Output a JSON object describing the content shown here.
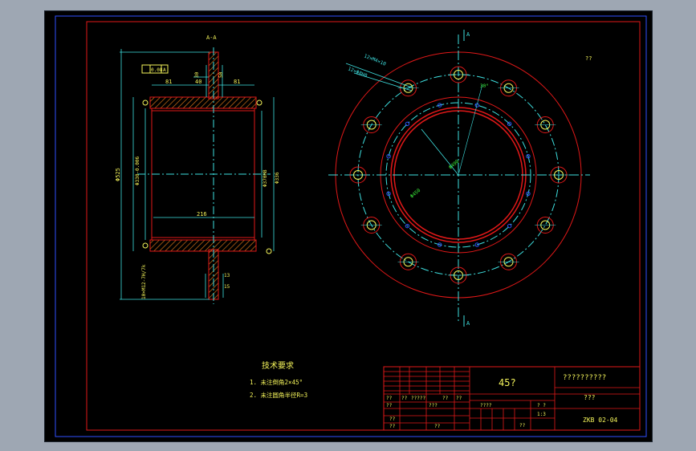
{
  "section_label": "A-A",
  "view_marks": {
    "top": "A",
    "bottom": "A"
  },
  "dims_section": {
    "d1": "81",
    "d2": "40",
    "d3": "30",
    "d4": "50",
    "d5": "81",
    "od": "Φ525",
    "id1": "Φ330-0.006",
    "id2": "Φ370H8",
    "id3": "Φ336",
    "length": "216",
    "bolt": "10×M12-7H/7k",
    "b1": "13",
    "b2": "15",
    "tol_a": "0.08",
    "tol_b": "A"
  },
  "dims_plan": {
    "holes1": "12×M4×10",
    "holes2": "12×Φ8H8",
    "ang": "30°",
    "dia1": "Φ490",
    "dia2": "Φ450",
    "corner": "??"
  },
  "tech_req": {
    "title": "技术要求",
    "item1": "1. 未注倒角2×45°",
    "item2": "2. 未注圆角半径R=3"
  },
  "title_block": {
    "material": "45?",
    "name": "??????????",
    "company": "???",
    "drawing_no": "ZKB 02-04",
    "cells": [
      "??",
      "??",
      "?????",
      "??",
      "??",
      "??",
      "???",
      "??",
      "??",
      "??",
      "????",
      "? ?",
      "??",
      "1:3"
    ]
  },
  "colors": {
    "frame": "#e01818",
    "cyan": "#3ee0e0",
    "hatch": "#e07818",
    "yellow": "#f3f35a",
    "green": "#3cf03c",
    "blue": "#3050ff"
  }
}
